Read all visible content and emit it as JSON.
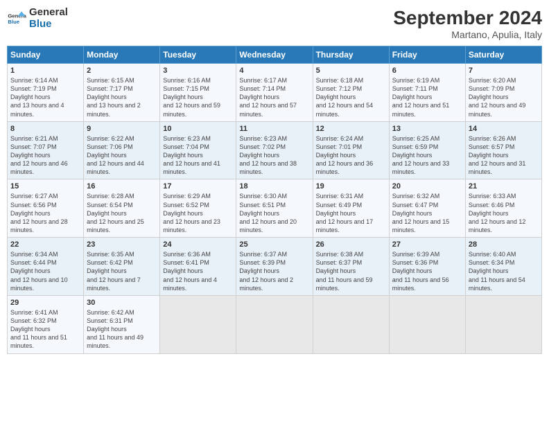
{
  "header": {
    "logo_line1": "General",
    "logo_line2": "Blue",
    "month_title": "September 2024",
    "subtitle": "Martano, Apulia, Italy"
  },
  "days_of_week": [
    "Sunday",
    "Monday",
    "Tuesday",
    "Wednesday",
    "Thursday",
    "Friday",
    "Saturday"
  ],
  "weeks": [
    [
      {
        "day": "1",
        "sunrise": "6:14 AM",
        "sunset": "7:19 PM",
        "daylight": "13 hours and 4 minutes."
      },
      {
        "day": "2",
        "sunrise": "6:15 AM",
        "sunset": "7:17 PM",
        "daylight": "13 hours and 2 minutes."
      },
      {
        "day": "3",
        "sunrise": "6:16 AM",
        "sunset": "7:15 PM",
        "daylight": "12 hours and 59 minutes."
      },
      {
        "day": "4",
        "sunrise": "6:17 AM",
        "sunset": "7:14 PM",
        "daylight": "12 hours and 57 minutes."
      },
      {
        "day": "5",
        "sunrise": "6:18 AM",
        "sunset": "7:12 PM",
        "daylight": "12 hours and 54 minutes."
      },
      {
        "day": "6",
        "sunrise": "6:19 AM",
        "sunset": "7:11 PM",
        "daylight": "12 hours and 51 minutes."
      },
      {
        "day": "7",
        "sunrise": "6:20 AM",
        "sunset": "7:09 PM",
        "daylight": "12 hours and 49 minutes."
      }
    ],
    [
      {
        "day": "8",
        "sunrise": "6:21 AM",
        "sunset": "7:07 PM",
        "daylight": "12 hours and 46 minutes."
      },
      {
        "day": "9",
        "sunrise": "6:22 AM",
        "sunset": "7:06 PM",
        "daylight": "12 hours and 44 minutes."
      },
      {
        "day": "10",
        "sunrise": "6:23 AM",
        "sunset": "7:04 PM",
        "daylight": "12 hours and 41 minutes."
      },
      {
        "day": "11",
        "sunrise": "6:23 AM",
        "sunset": "7:02 PM",
        "daylight": "12 hours and 38 minutes."
      },
      {
        "day": "12",
        "sunrise": "6:24 AM",
        "sunset": "7:01 PM",
        "daylight": "12 hours and 36 minutes."
      },
      {
        "day": "13",
        "sunrise": "6:25 AM",
        "sunset": "6:59 PM",
        "daylight": "12 hours and 33 minutes."
      },
      {
        "day": "14",
        "sunrise": "6:26 AM",
        "sunset": "6:57 PM",
        "daylight": "12 hours and 31 minutes."
      }
    ],
    [
      {
        "day": "15",
        "sunrise": "6:27 AM",
        "sunset": "6:56 PM",
        "daylight": "12 hours and 28 minutes."
      },
      {
        "day": "16",
        "sunrise": "6:28 AM",
        "sunset": "6:54 PM",
        "daylight": "12 hours and 25 minutes."
      },
      {
        "day": "17",
        "sunrise": "6:29 AM",
        "sunset": "6:52 PM",
        "daylight": "12 hours and 23 minutes."
      },
      {
        "day": "18",
        "sunrise": "6:30 AM",
        "sunset": "6:51 PM",
        "daylight": "12 hours and 20 minutes."
      },
      {
        "day": "19",
        "sunrise": "6:31 AM",
        "sunset": "6:49 PM",
        "daylight": "12 hours and 17 minutes."
      },
      {
        "day": "20",
        "sunrise": "6:32 AM",
        "sunset": "6:47 PM",
        "daylight": "12 hours and 15 minutes."
      },
      {
        "day": "21",
        "sunrise": "6:33 AM",
        "sunset": "6:46 PM",
        "daylight": "12 hours and 12 minutes."
      }
    ],
    [
      {
        "day": "22",
        "sunrise": "6:34 AM",
        "sunset": "6:44 PM",
        "daylight": "12 hours and 10 minutes."
      },
      {
        "day": "23",
        "sunrise": "6:35 AM",
        "sunset": "6:42 PM",
        "daylight": "12 hours and 7 minutes."
      },
      {
        "day": "24",
        "sunrise": "6:36 AM",
        "sunset": "6:41 PM",
        "daylight": "12 hours and 4 minutes."
      },
      {
        "day": "25",
        "sunrise": "6:37 AM",
        "sunset": "6:39 PM",
        "daylight": "12 hours and 2 minutes."
      },
      {
        "day": "26",
        "sunrise": "6:38 AM",
        "sunset": "6:37 PM",
        "daylight": "11 hours and 59 minutes."
      },
      {
        "day": "27",
        "sunrise": "6:39 AM",
        "sunset": "6:36 PM",
        "daylight": "11 hours and 56 minutes."
      },
      {
        "day": "28",
        "sunrise": "6:40 AM",
        "sunset": "6:34 PM",
        "daylight": "11 hours and 54 minutes."
      }
    ],
    [
      {
        "day": "29",
        "sunrise": "6:41 AM",
        "sunset": "6:32 PM",
        "daylight": "11 hours and 51 minutes."
      },
      {
        "day": "30",
        "sunrise": "6:42 AM",
        "sunset": "6:31 PM",
        "daylight": "11 hours and 49 minutes."
      },
      null,
      null,
      null,
      null,
      null
    ]
  ]
}
